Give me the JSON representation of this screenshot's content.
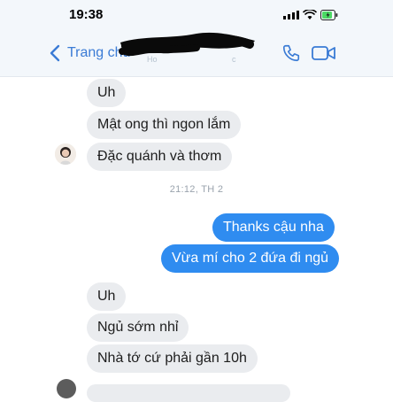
{
  "status_bar": {
    "time": "19:38",
    "battery_color": "#4cd964"
  },
  "header": {
    "back_label": "Trang chủ",
    "faint_text_left": "Ho",
    "faint_text_right": "c",
    "accent_color": "#3a7bd5",
    "icons": [
      "chevron-left-icon",
      "phone-icon",
      "video-camera-icon"
    ]
  },
  "conversation": {
    "timestamp": "21:12, TH 2",
    "messages": [
      {
        "side": "received",
        "text": "Uh"
      },
      {
        "side": "received",
        "text": "Mật ong thì ngon lắm"
      },
      {
        "side": "received",
        "text": "Đặc quánh và thơm"
      },
      {
        "side": "sent",
        "text": "Thanks cậu nha"
      },
      {
        "side": "sent",
        "text": "Vừa mí cho 2 đứa đi ngủ"
      },
      {
        "side": "received",
        "text": "Uh"
      },
      {
        "side": "received",
        "text": "Ngủ sớm nhỉ"
      },
      {
        "side": "received",
        "text": "Nhà tớ cứ phải gần 10h"
      }
    ],
    "sent_color": "#2f8cf0",
    "received_color": "#eaecef"
  }
}
